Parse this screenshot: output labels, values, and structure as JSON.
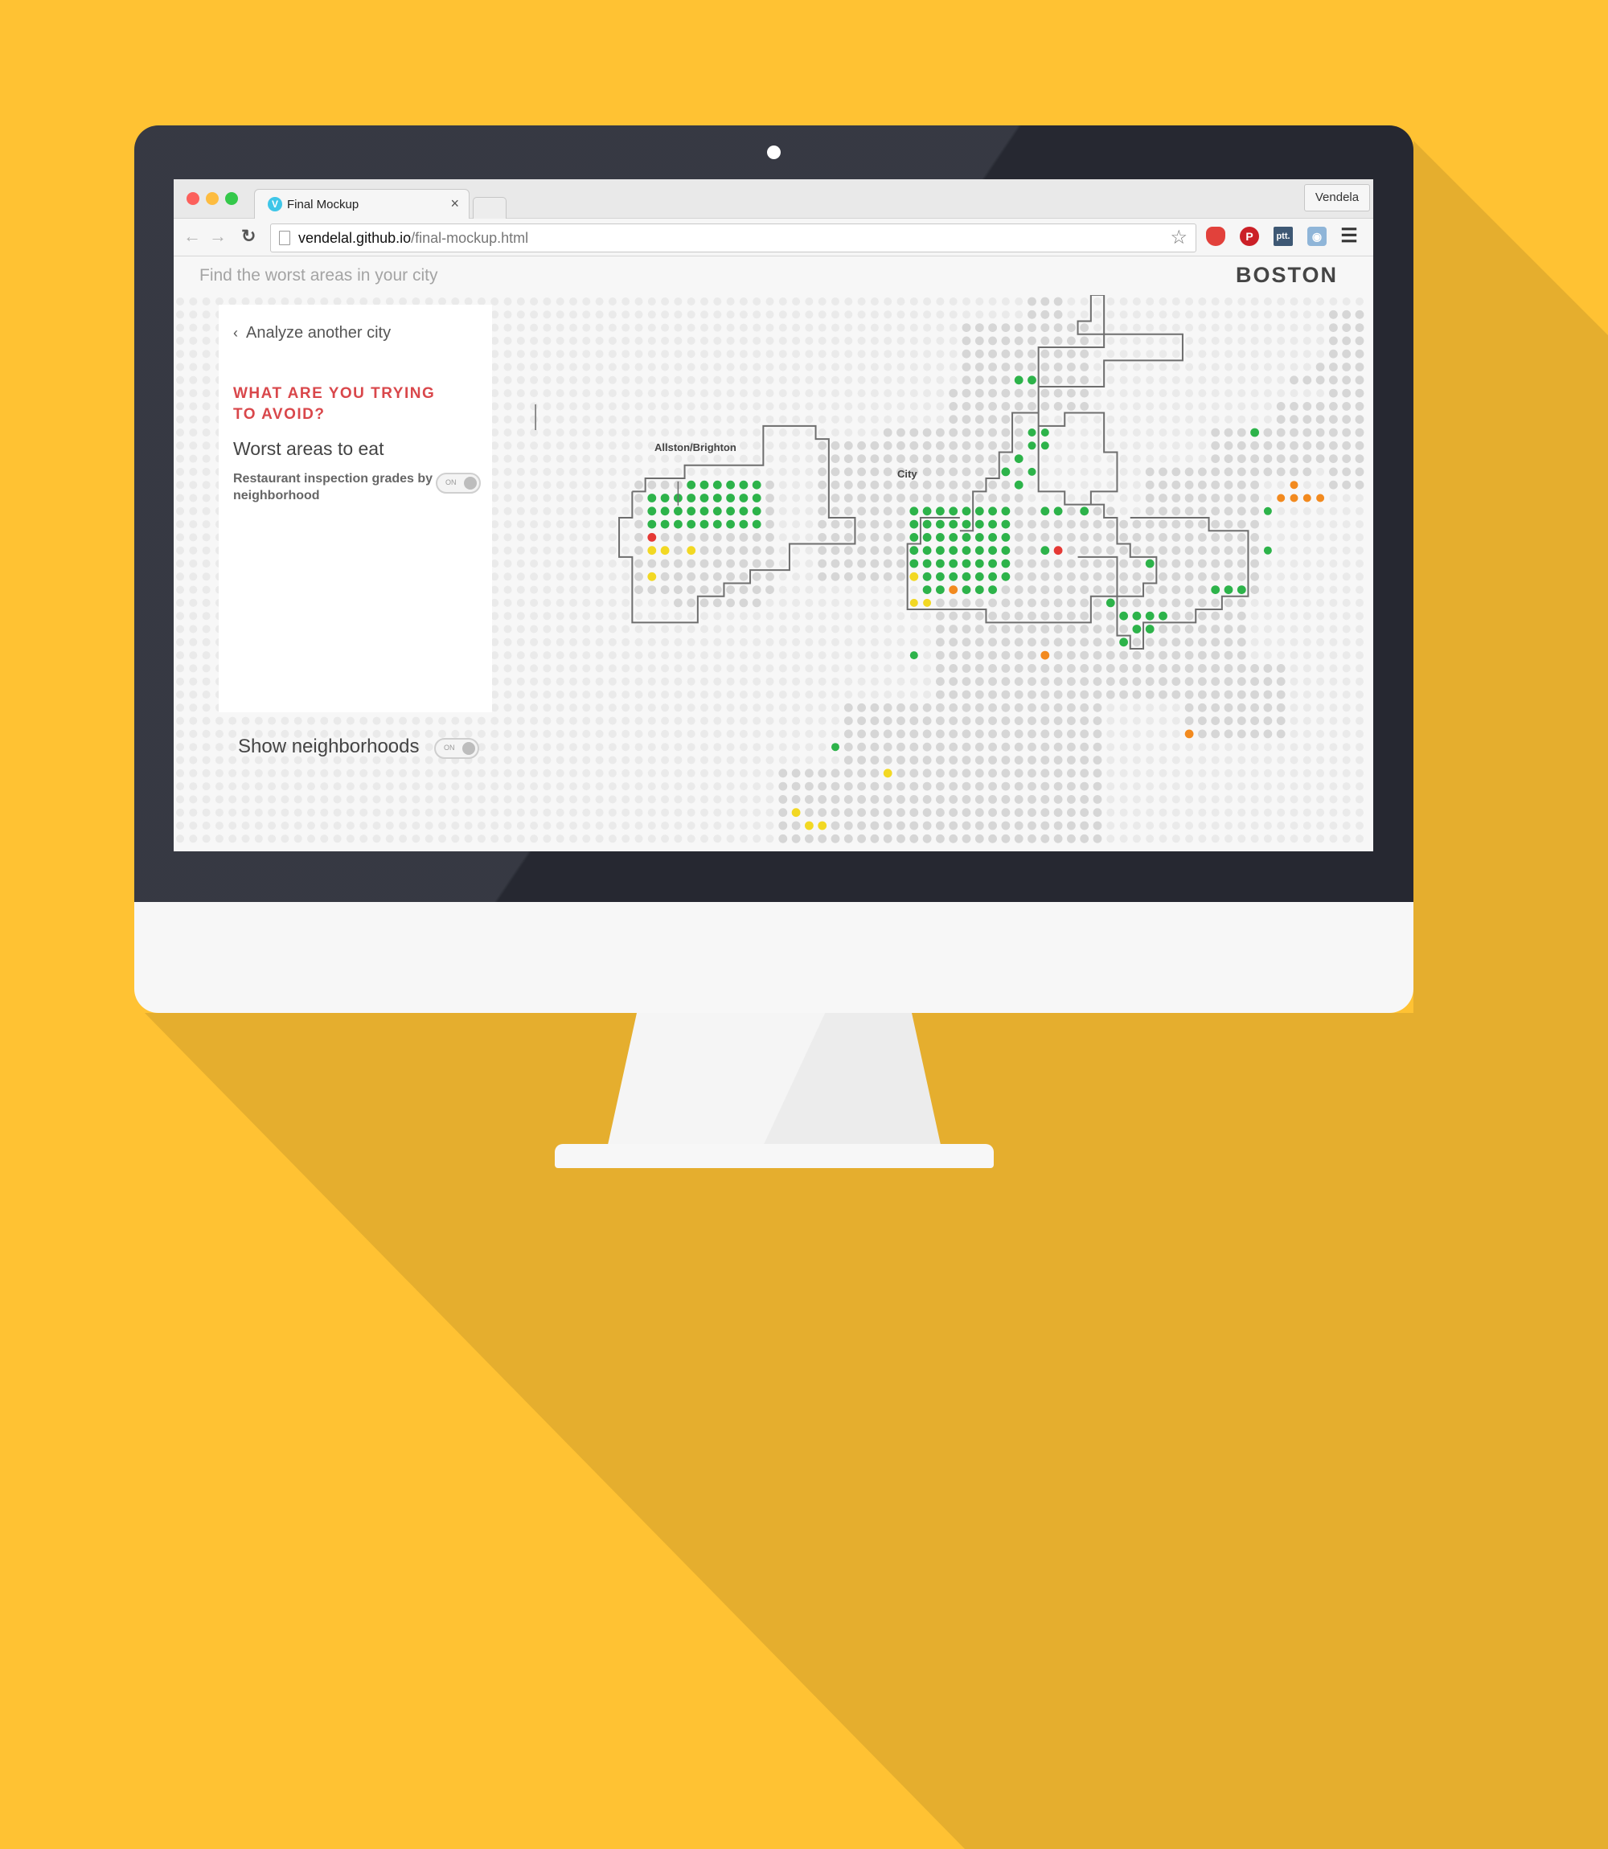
{
  "browser": {
    "tab_title": "Final Mockup",
    "tab_close": "×",
    "favicon_letter": "V",
    "profile_name": "Vendela",
    "url_host": "vendelal.github.io",
    "url_path": "/final-mockup.html",
    "extensions": [
      "adblock-shield-icon",
      "pinterest-icon",
      "ptt-icon",
      "camera-icon",
      "menu-icon"
    ],
    "ptt_label": "ptt."
  },
  "app": {
    "tagline": "Find the worst areas in your city",
    "city": "BOSTON",
    "back_label": "Analyze another city",
    "question": "WHAT ARE YOU TRYING TO AVOID?",
    "option_label": "Worst areas to eat",
    "option_description": "Restaurant inspection grades by neighborhood",
    "option_toggle": "ON",
    "show_neighborhoods_label": "Show neighborhoods",
    "show_neighborhoods_toggle": "ON"
  },
  "map": {
    "neighborhood_labels": [
      "Allston/Brighton",
      "City"
    ],
    "grade_colors": {
      "background": "#EAEAEA",
      "land": "#D6D6D6",
      "good": "#2DB34A",
      "fair": "#F2D823",
      "poor": "#F28A1F",
      "bad": "#E53935",
      "boundary": "#6E6E6E"
    }
  }
}
